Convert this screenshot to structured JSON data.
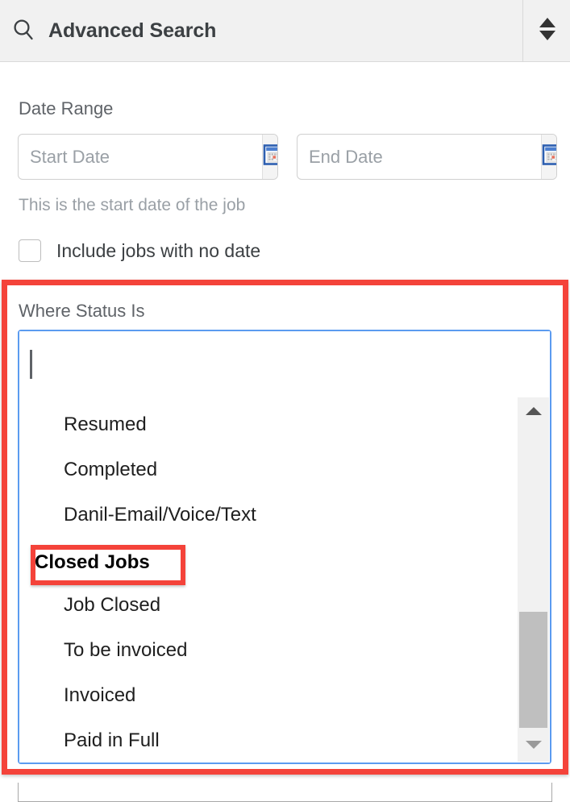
{
  "header": {
    "title": "Advanced Search",
    "search_icon": "search-icon",
    "collapse_icon": "sort-updown-icon"
  },
  "date_range": {
    "label": "Date Range",
    "start": {
      "placeholder": "Start Date",
      "value": "",
      "calendar_icon": "calendar-icon"
    },
    "end": {
      "placeholder": "End Date",
      "value": "",
      "calendar_icon": "calendar-icon"
    },
    "hint": "This is the start date of the job",
    "checkbox": {
      "label": "Include jobs with no date",
      "checked": false
    }
  },
  "status_filter": {
    "label": "Where Status Is",
    "input_value": "",
    "options": [
      {
        "label": "Resumed",
        "type": "option"
      },
      {
        "label": "Completed",
        "type": "option"
      },
      {
        "label": "Danil-Email/Voice/Text",
        "type": "option"
      },
      {
        "label": "Closed Jobs",
        "type": "group"
      },
      {
        "label": "Job Closed",
        "type": "option"
      },
      {
        "label": "To be invoiced",
        "type": "option"
      },
      {
        "label": "Invoiced",
        "type": "option"
      },
      {
        "label": "Paid in Full",
        "type": "option"
      }
    ],
    "scrollbar": {
      "up_arrow_icon": "triangle-up-icon",
      "down_arrow_icon": "triangle-down-icon"
    }
  },
  "colors": {
    "highlight_red": "#f4433a",
    "focus_blue": "#5b9bf0",
    "header_bg": "#f1f1f1",
    "calendar_blue": "#2d5fb0",
    "calendar_red_dot": "#e8705a"
  }
}
